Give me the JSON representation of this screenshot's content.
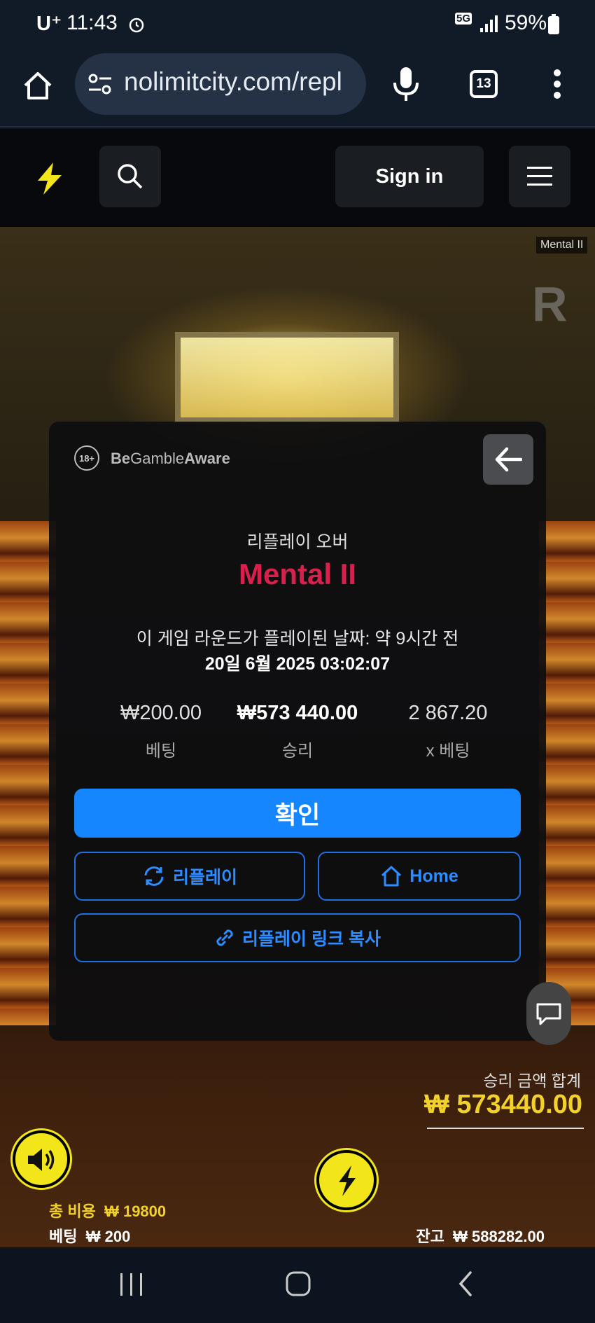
{
  "status_bar": {
    "carrier": "U⁺",
    "time": "11:43",
    "network": "5G",
    "battery": "59%"
  },
  "browser": {
    "url": "nolimitcity.com/repl",
    "tab_count": "13"
  },
  "site_nav": {
    "sign_in_label": "Sign in"
  },
  "game": {
    "badge": "Mental II",
    "total_win_label": "승리 금액 합계",
    "total_win_value": "₩ 573440.00",
    "total_cost_label": "총 비용",
    "total_cost_value": "₩ 19800",
    "bet_label": "베팅",
    "bet_value": "₩ 200",
    "balance_label": "잔고",
    "balance_value": "₩ 588282.00"
  },
  "modal": {
    "gamble_aware_be": "Be",
    "gamble_aware_gamble": "Gamble",
    "gamble_aware_aware": "Aware",
    "age_badge": "18+",
    "subtitle": "리플레이 오버",
    "title": "Mental II",
    "played_line": "이 게임 라운드가 플레이된 날짜: 약 9시간 전",
    "date_line": "20일 6월 2025 03:02:07",
    "stats": [
      {
        "value": "₩200.00",
        "label": "베팅"
      },
      {
        "value": "₩573 440.00",
        "label": "승리"
      },
      {
        "value": "2 867.20",
        "label": "x 베팅"
      }
    ],
    "confirm_label": "확인",
    "replay_label": "리플레이",
    "home_label": "Home",
    "copy_link_label": "리플레이 링크 복사"
  },
  "colors": {
    "accent_blue": "#1686ff",
    "title_red": "#d8204c",
    "brand_yellow": "#f2e61a"
  }
}
